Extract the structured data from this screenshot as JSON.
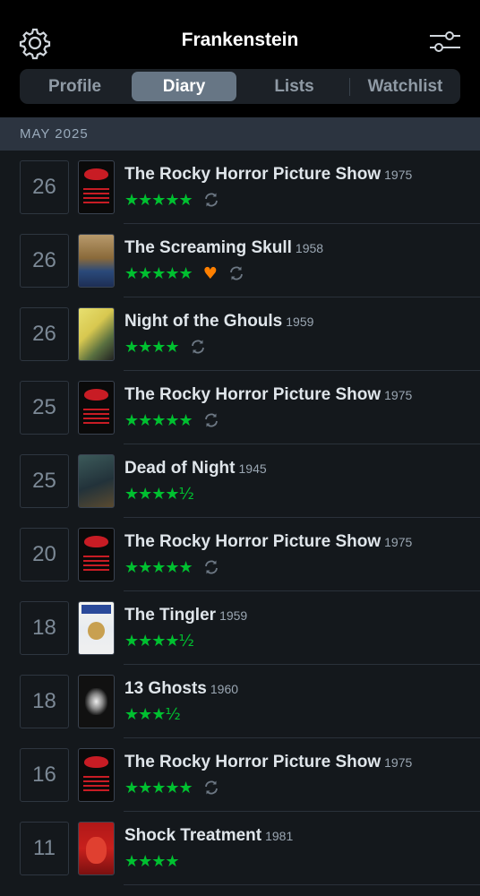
{
  "header": {
    "title": "Frankenstein",
    "tabs": [
      {
        "label": "Profile",
        "active": false
      },
      {
        "label": "Diary",
        "active": true
      },
      {
        "label": "Lists",
        "active": false
      },
      {
        "label": "Watchlist",
        "active": false
      }
    ],
    "left_icon": "gear-icon",
    "right_icon": "filter-sliders-icon"
  },
  "diary": {
    "month": "MAY 2025",
    "entries": [
      {
        "day": "26",
        "title": "The Rocky Horror Picture Show",
        "year": "1975",
        "stars": "★★★★★",
        "liked": false,
        "rewatch": true,
        "poster": "rocky"
      },
      {
        "day": "26",
        "title": "The Screaming Skull",
        "year": "1958",
        "stars": "★★★★★",
        "liked": true,
        "rewatch": true,
        "poster": "skull"
      },
      {
        "day": "26",
        "title": "Night of the Ghouls",
        "year": "1959",
        "stars": "★★★★",
        "liked": false,
        "rewatch": true,
        "poster": "ghouls"
      },
      {
        "day": "25",
        "title": "The Rocky Horror Picture Show",
        "year": "1975",
        "stars": "★★★★★",
        "liked": false,
        "rewatch": true,
        "poster": "rocky"
      },
      {
        "day": "25",
        "title": "Dead of Night",
        "year": "1945",
        "stars": "★★★★½",
        "liked": false,
        "rewatch": false,
        "poster": "dead"
      },
      {
        "day": "20",
        "title": "The Rocky Horror Picture Show",
        "year": "1975",
        "stars": "★★★★★",
        "liked": false,
        "rewatch": true,
        "poster": "rocky"
      },
      {
        "day": "18",
        "title": "The Tingler",
        "year": "1959",
        "stars": "★★★★½",
        "liked": false,
        "rewatch": false,
        "poster": "tingler"
      },
      {
        "day": "18",
        "title": "13 Ghosts",
        "year": "1960",
        "stars": "★★★½",
        "liked": false,
        "rewatch": false,
        "poster": "ghosts"
      },
      {
        "day": "16",
        "title": "The Rocky Horror Picture Show",
        "year": "1975",
        "stars": "★★★★★",
        "liked": false,
        "rewatch": true,
        "poster": "rocky"
      },
      {
        "day": "11",
        "title": "Shock Treatment",
        "year": "1981",
        "stars": "★★★★",
        "liked": false,
        "rewatch": false,
        "poster": "shock"
      }
    ]
  },
  "colors": {
    "star": "#00c030",
    "heart": "#ff8000",
    "background": "#14181c",
    "header": "#000000"
  }
}
